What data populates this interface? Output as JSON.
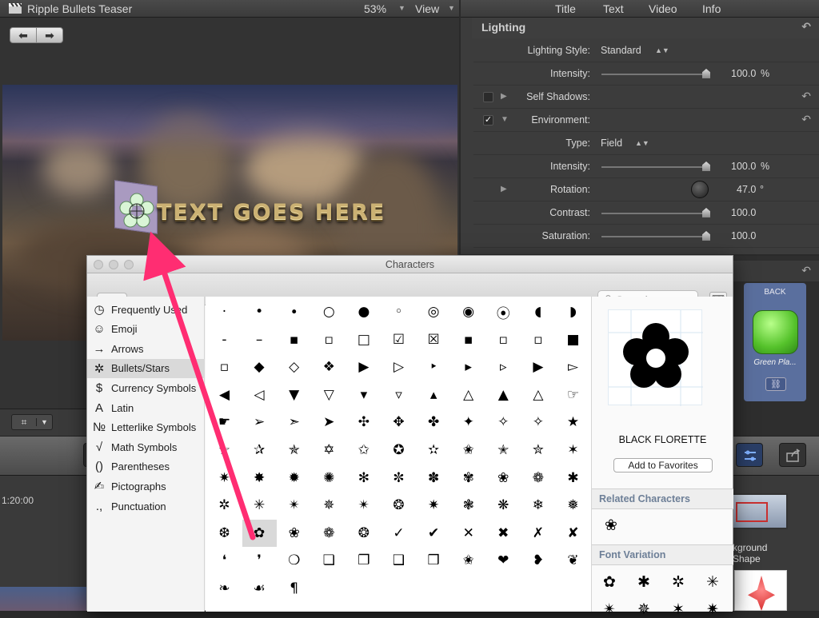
{
  "viewer": {
    "title": "Ripple Bullets Teaser",
    "zoom": "53%",
    "view_label": "View",
    "video_text": "TEXT GOES HERE",
    "bullet_glyph": "✿"
  },
  "inspector": {
    "tabs": [
      "Title",
      "Text",
      "Video",
      "Info"
    ],
    "section": "Lighting",
    "rows": [
      {
        "label": "Lighting Style:",
        "value": "Standard",
        "type": "popup"
      },
      {
        "label": "Intensity:",
        "value": "100.0",
        "unit": "%",
        "type": "slider",
        "level": 1.0
      },
      {
        "label": "Self Shadows:",
        "type": "check",
        "checked": false
      },
      {
        "label": "Environment:",
        "type": "check",
        "checked": true
      },
      {
        "label": "Type:",
        "value": "Field",
        "type": "popup"
      },
      {
        "label": "Intensity:",
        "value": "100.0",
        "unit": "%",
        "type": "slider",
        "level": 1.0
      },
      {
        "label": "Rotation:",
        "value": "47.0",
        "unit": "°",
        "type": "dial"
      },
      {
        "label": "Contrast:",
        "value": "100.0",
        "type": "slider",
        "level": 1.0
      },
      {
        "label": "Saturation:",
        "value": "100.0",
        "type": "slider",
        "level": 1.0
      }
    ]
  },
  "right_panel": {
    "back_label": "BACK",
    "green_label": "Green Pla...",
    "bg_label1": "kground",
    "bg_label2": "Shape"
  },
  "timeline": {
    "timecode": "1:20:00"
  },
  "characters": {
    "title": "Characters",
    "search_placeholder": "Search",
    "categories": [
      {
        "icon": "◷",
        "label": "Frequently Used"
      },
      {
        "icon": "☺",
        "label": "Emoji"
      },
      {
        "icon": "→",
        "label": "Arrows"
      },
      {
        "icon": "✲",
        "label": "Bullets/Stars"
      },
      {
        "icon": "$",
        "label": "Currency Symbols"
      },
      {
        "icon": "A",
        "label": "Latin"
      },
      {
        "icon": "№",
        "label": "Letterlike Symbols"
      },
      {
        "icon": "√",
        "label": "Math Symbols"
      },
      {
        "icon": "()",
        "label": "Parentheses"
      },
      {
        "icon": "✍",
        "label": "Pictographs"
      },
      {
        "icon": ".,",
        "label": "Punctuation"
      }
    ],
    "selected_category": "Bullets/Stars",
    "grid": [
      [
        "·",
        "•",
        "∙",
        "○",
        "●",
        "◦",
        "◎",
        "◉",
        "⦿",
        "◖",
        "◗"
      ],
      [
        "‐",
        "–",
        "▪",
        "▫",
        "□",
        "☑",
        "☒",
        "▪",
        "▫",
        "▫",
        "■"
      ],
      [
        "▫",
        "◆",
        "◇",
        "❖",
        "▶",
        "▷",
        "‣",
        "▸",
        "▹",
        "▶",
        "▻"
      ],
      [
        "◀",
        "◁",
        "▼",
        "▽",
        "▾",
        "▿",
        "▴",
        "△",
        "▲",
        "△",
        "☞"
      ],
      [
        "☛",
        "➢",
        "➣",
        "➤",
        "✣",
        "✥",
        "✤",
        "✦",
        "✧",
        "✧",
        "★"
      ],
      [
        "☆",
        "✰",
        "✯",
        "✡",
        "✩",
        "✪",
        "✫",
        "✬",
        "✭",
        "✮",
        "✶"
      ],
      [
        "✷",
        "✸",
        "✹",
        "✺",
        "✻",
        "✼",
        "✽",
        "✾",
        "❀",
        "❁",
        "✱"
      ],
      [
        "✲",
        "✳",
        "✴",
        "✵",
        "✴",
        "❂",
        "✷",
        "❃",
        "❋",
        "❄",
        "❅"
      ],
      [
        "❆",
        "✿",
        "❀",
        "❁",
        "❂",
        "✓",
        "✔",
        "✕",
        "✖",
        "✗",
        "✘"
      ],
      [
        "❛",
        "❜",
        "❍",
        "❏",
        "❐",
        "❑",
        "❒",
        "✬",
        "❤",
        "❥",
        "❦"
      ],
      [
        "❧",
        "☙",
        "¶"
      ]
    ],
    "selected_char": "✿",
    "selected_name": "BLACK FLORETTE",
    "add_favorites": "Add to Favorites",
    "related_header": "Related Characters",
    "related": [
      "❀"
    ],
    "font_variation_header": "Font Variation",
    "variations": [
      "✿",
      "✱",
      "✲",
      "✳",
      "✴",
      "✵",
      "✶",
      "✷"
    ]
  }
}
